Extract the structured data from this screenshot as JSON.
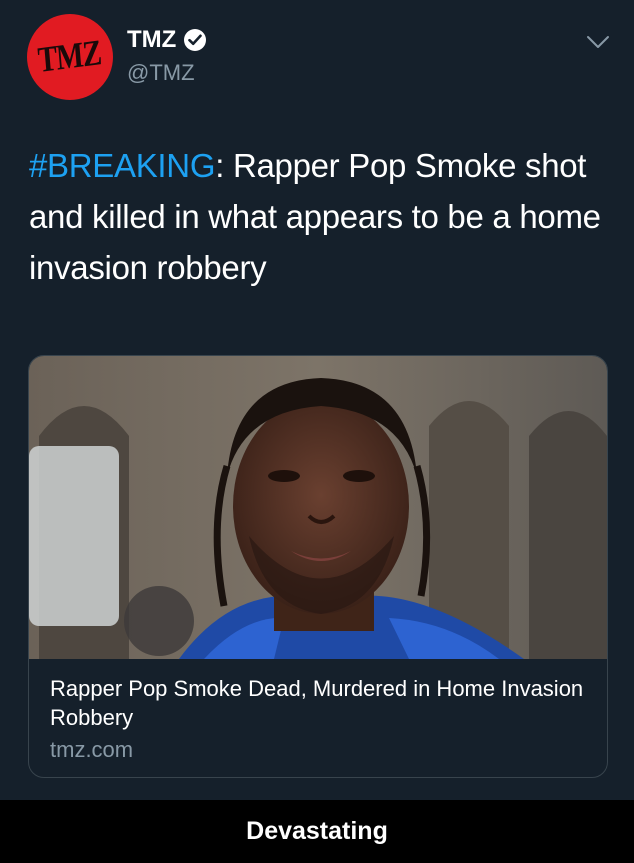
{
  "tweet": {
    "author": {
      "display_name": "TMZ",
      "handle": "@TMZ",
      "avatar_text": "TMZ",
      "verified": true
    },
    "text": {
      "hashtag": "#BREAKING",
      "body": ": Rapper Pop Smoke shot and killed in what appears to be a home invasion robbery"
    },
    "card": {
      "title": "Rapper Pop Smoke Dead, Murdered in Home Invasion Robbery",
      "domain": "tmz.com"
    }
  },
  "caption": {
    "text": "Devastating"
  },
  "colors": {
    "background": "#15202b",
    "hashtag": "#1da1f2",
    "secondary_text": "#8899a6",
    "avatar_red": "#e11b22",
    "caption_bg": "#000000"
  },
  "icons": [
    "verified-badge-icon",
    "chevron-down-icon"
  ]
}
